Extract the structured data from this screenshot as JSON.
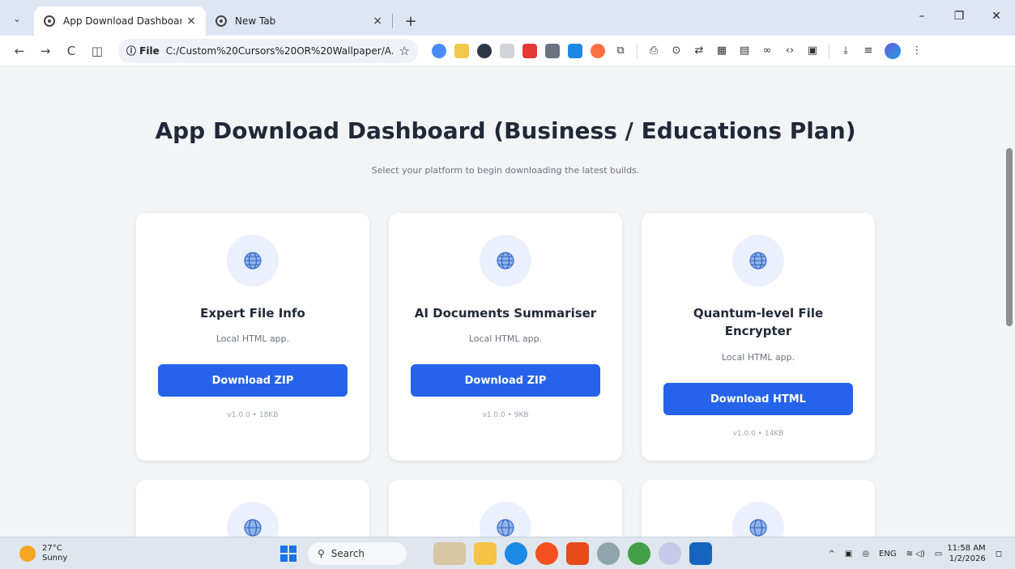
{
  "browser": {
    "tabs": [
      {
        "title": "App Download Dashboard",
        "close": "×"
      },
      {
        "title": "New Tab",
        "close": "×"
      }
    ],
    "new_tab": "+",
    "menu": "⌄",
    "window_controls": {
      "minimize": "–",
      "restore": "❐",
      "close": "✕"
    },
    "address": {
      "chip": "ⓘ File",
      "url": "C:/Custom%20Cursors%20OR%20Wallpaper/A...",
      "star": "☆"
    },
    "nav": {
      "back": "←",
      "forward": "→",
      "reload": "C",
      "split": "◫"
    }
  },
  "page": {
    "title": "App Download Dashboard (Business / Educations Plan)",
    "subtitle": "Select your platform to begin downloading the latest builds.",
    "apps": [
      {
        "name": "Expert File Info",
        "desc": "Local HTML app.",
        "button": "Download ZIP",
        "meta": "v1.0.0 • 18KB"
      },
      {
        "name": "AI Documents Summariser",
        "desc": "Local HTML app.",
        "button": "Download ZIP",
        "meta": "v1.0.0 • 9KB"
      },
      {
        "name": "Quantum-level File Encrypter",
        "desc": "Local HTML app.",
        "button": "Download HTML",
        "meta": "v1.0.0 • 14KB"
      }
    ]
  },
  "taskbar": {
    "weather": {
      "temp": "27°C",
      "cond": "Sunny"
    },
    "search": "Search",
    "tray": {
      "lang": "ENG",
      "time": "11:58 AM",
      "date": "1/2/2026"
    }
  },
  "colors": {
    "accent": "#2563eb",
    "icon_bg": "#eaf1fd",
    "page_bg": "#f3f4f6"
  }
}
